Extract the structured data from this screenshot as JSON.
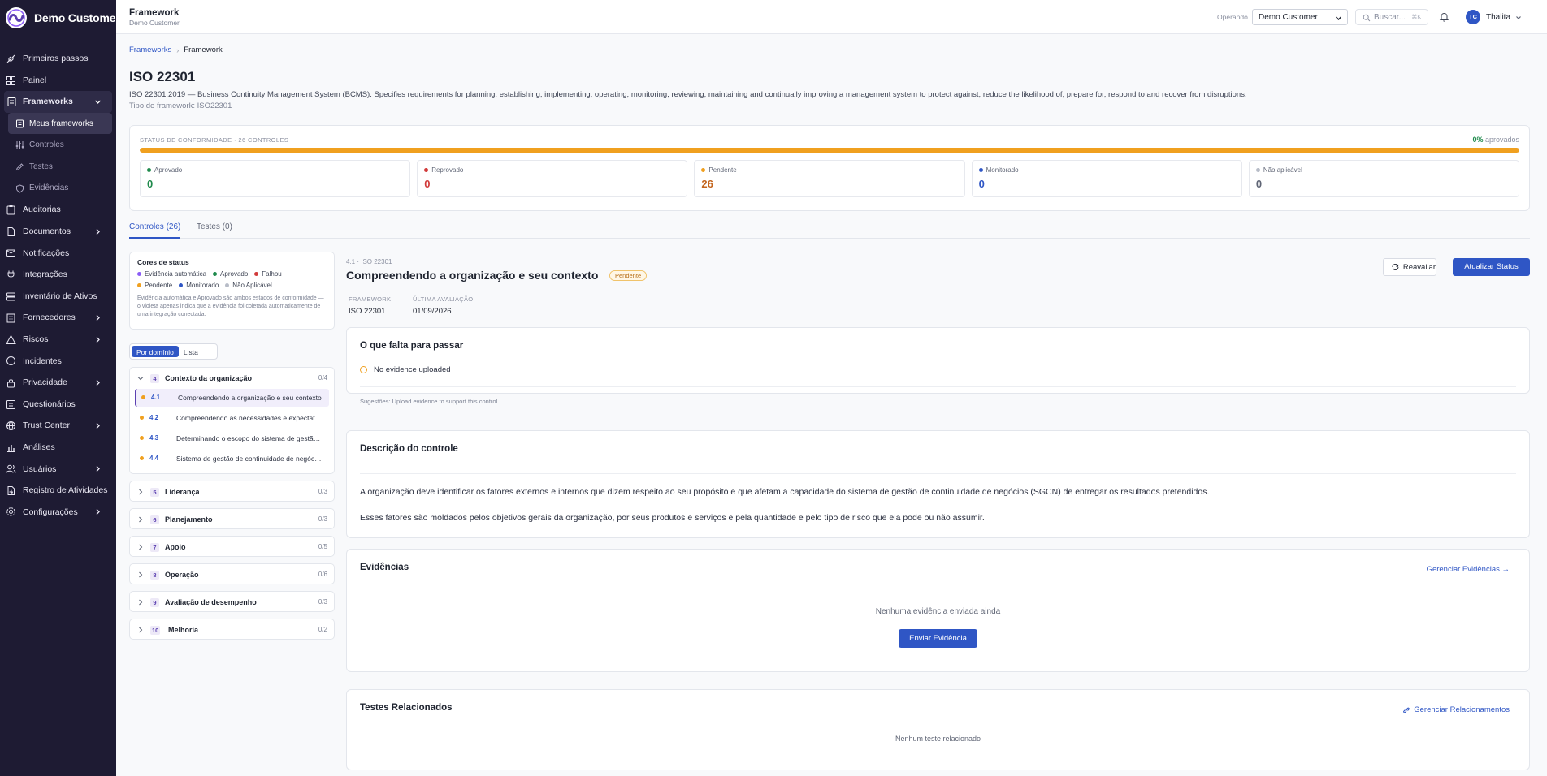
{
  "brand": {
    "name": "Demo Customer"
  },
  "sidebar": {
    "items": [
      {
        "label": "Primeiros passos"
      },
      {
        "label": "Painel"
      },
      {
        "label": "Frameworks"
      },
      {
        "label": "Meus frameworks"
      },
      {
        "label": "Controles"
      },
      {
        "label": "Testes"
      },
      {
        "label": "Evidências"
      },
      {
        "label": "Auditorias"
      },
      {
        "label": "Documentos"
      },
      {
        "label": "Notificações"
      },
      {
        "label": "Integrações"
      },
      {
        "label": "Inventário de Ativos"
      },
      {
        "label": "Fornecedores"
      },
      {
        "label": "Riscos"
      },
      {
        "label": "Incidentes"
      },
      {
        "label": "Privacidade"
      },
      {
        "label": "Questionários"
      },
      {
        "label": "Trust Center"
      },
      {
        "label": "Análises"
      },
      {
        "label": "Usuários"
      },
      {
        "label": "Registro de Atividades"
      },
      {
        "label": "Configurações"
      }
    ]
  },
  "topbar": {
    "title": "Framework",
    "subtitle": "Demo Customer",
    "operando_label": "Operando",
    "org_select": "Demo Customer",
    "search_placeholder": "Buscar...",
    "search_shortcut": "⌘K",
    "user_initials": "TC",
    "user_name": "Thalita"
  },
  "breadcrumb": {
    "parent": "Frameworks",
    "sep": "›",
    "current": "Framework"
  },
  "framework": {
    "title": "ISO 22301",
    "description": "ISO 22301:2019 — Business Continuity Management System (BCMS). Specifies requirements for planning, establishing, implementing, operating, monitoring, reviewing, maintaining and continually improving a management system to protect against, reduce the likelihood of, prepare for, respond to and recover from disruptions.",
    "type_line": "Tipo de framework: ISO22301"
  },
  "compliance": {
    "label": "STATUS DE CONFORMIDADE · 26 CONTROLES",
    "pct": "0%",
    "pct_suffix": "aprovados",
    "bar_fill_fraction": 1.0,
    "bar_color": "#f0a01f",
    "stats": [
      {
        "label": "Aprovado",
        "value": "0",
        "color": "#1f8a4c"
      },
      {
        "label": "Reprovado",
        "value": "0",
        "color": "#d13a3a"
      },
      {
        "label": "Pendente",
        "value": "26",
        "color": "#c4661f",
        "dot": "#f0a01f"
      },
      {
        "label": "Monitorado",
        "value": "0",
        "color": "#2f56c5"
      },
      {
        "label": "Não aplicável",
        "value": "0",
        "color": "#5f6575",
        "dot": "#b7bcc7"
      }
    ]
  },
  "tabs": {
    "controls": "Controles (26)",
    "tests": "Testes (0)"
  },
  "legend": {
    "title": "Cores de status",
    "items_row1": [
      "Evidência automática",
      "Aprovado",
      "Falhou"
    ],
    "items_row2": [
      "Pendente",
      "Monitorado",
      "Não Aplicável"
    ],
    "colors": {
      "auto": "#8b5cf6",
      "approved": "#1f8a4c",
      "failed": "#d13a3a",
      "pending": "#f0a01f",
      "monitored": "#2f56c5",
      "na": "#b7bcc7"
    },
    "note": "Evidência automática e Aprovado são ambos estados de conformidade — o violeta apenas indica que a evidência foi coletada automaticamente de uma integração conectada."
  },
  "view_toggle": {
    "by_domain": "Por domínio",
    "list": "Lista"
  },
  "domains": [
    {
      "num": "4",
      "name": "Contexto da organização",
      "count": "0/4",
      "controls": [
        {
          "code": "4.1",
          "title": "Compreendendo a organização e seu contexto"
        },
        {
          "code": "4.2",
          "title": "Compreendendo as necessidades e expectativas das partes interessadas"
        },
        {
          "code": "4.3",
          "title": "Determinando o escopo do sistema de gestão de continuidade de negócios"
        },
        {
          "code": "4.4",
          "title": "Sistema de gestão de continuidade de negócios"
        }
      ]
    },
    {
      "num": "5",
      "name": "Liderança",
      "count": "0/3"
    },
    {
      "num": "6",
      "name": "Planejamento",
      "count": "0/3"
    },
    {
      "num": "7",
      "name": "Apoio",
      "count": "0/5"
    },
    {
      "num": "8",
      "name": "Operação",
      "count": "0/6"
    },
    {
      "num": "9",
      "name": "Avaliação de desempenho",
      "count": "0/3"
    },
    {
      "num": "10",
      "name": "Melhoria",
      "count": "0/2"
    }
  ],
  "control": {
    "meta": "4.1 · ISO 22301",
    "title": "Compreendendo a organização e seu contexto",
    "status": "Pendente",
    "reassess_label": "Reavaliar",
    "update_label": "Atualizar Status",
    "framework_label": "FRAMEWORK",
    "framework_value": "ISO 22301",
    "last_eval_label": "ÚLTIMA AVALIAÇÃO",
    "last_eval_value": "01/09/2026"
  },
  "missing": {
    "title": "O que falta para passar",
    "item": "No evidence uploaded",
    "suggestion": "Sugestões: Upload evidence to support this control"
  },
  "description_card": {
    "title": "Descrição do controle",
    "p1": "A organização deve identificar os fatores externos e internos que dizem respeito ao seu propósito e que afetam a capacidade do sistema de gestão de continuidade de negócios (SGCN) de entregar os resultados pretendidos.",
    "p2": "Esses fatores são moldados pelos objetivos gerais da organização, por seus produtos e serviços e pela quantidade e pelo tipo de risco que ela pode ou não assumir."
  },
  "evidence": {
    "title": "Evidências",
    "manage_label": "Gerenciar Evidências →",
    "empty": "Nenhuma evidência enviada ainda",
    "send_label": "Enviar Evidência"
  },
  "related_tests": {
    "title": "Testes Relacionados",
    "manage_label": "Gerenciar Relacionamentos",
    "empty": "Nenhum teste relacionado"
  }
}
